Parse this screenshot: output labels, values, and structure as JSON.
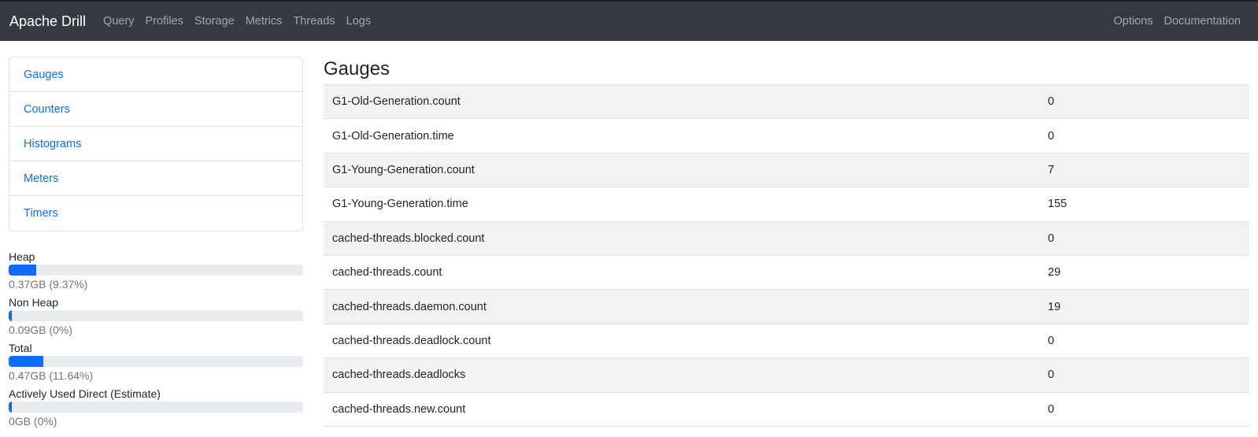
{
  "navbar": {
    "brand": "Apache Drill",
    "left_links": [
      "Query",
      "Profiles",
      "Storage",
      "Metrics",
      "Threads",
      "Logs"
    ],
    "right_links": [
      "Options",
      "Documentation"
    ]
  },
  "sidebar": {
    "items": [
      {
        "label": "Gauges"
      },
      {
        "label": "Counters"
      },
      {
        "label": "Histograms"
      },
      {
        "label": "Meters"
      },
      {
        "label": "Timers"
      }
    ]
  },
  "memory": [
    {
      "label": "Heap",
      "value": "0.37GB (9.37%)",
      "percent": 9.37
    },
    {
      "label": "Non Heap",
      "value": "0.09GB (0%)",
      "percent": 0
    },
    {
      "label": "Total",
      "value": "0.47GB (11.64%)",
      "percent": 11.64
    },
    {
      "label": "Actively Used Direct (Estimate)",
      "value": "0GB (0%)",
      "percent": 0
    }
  ],
  "main": {
    "title": "Gauges",
    "rows": [
      {
        "name": "G1-Old-Generation.count",
        "value": "0"
      },
      {
        "name": "G1-Old-Generation.time",
        "value": "0"
      },
      {
        "name": "G1-Young-Generation.count",
        "value": "7"
      },
      {
        "name": "G1-Young-Generation.time",
        "value": "155"
      },
      {
        "name": "cached-threads.blocked.count",
        "value": "0"
      },
      {
        "name": "cached-threads.count",
        "value": "29"
      },
      {
        "name": "cached-threads.daemon.count",
        "value": "19"
      },
      {
        "name": "cached-threads.deadlock.count",
        "value": "0"
      },
      {
        "name": "cached-threads.deadlocks",
        "value": "0"
      },
      {
        "name": "cached-threads.new.count",
        "value": "0"
      }
    ]
  },
  "colors": {
    "navbar_bg": "#343a40",
    "link": "#0d6efd",
    "progress_fill": "#0d6efd",
    "stripe": "#f2f2f2"
  }
}
